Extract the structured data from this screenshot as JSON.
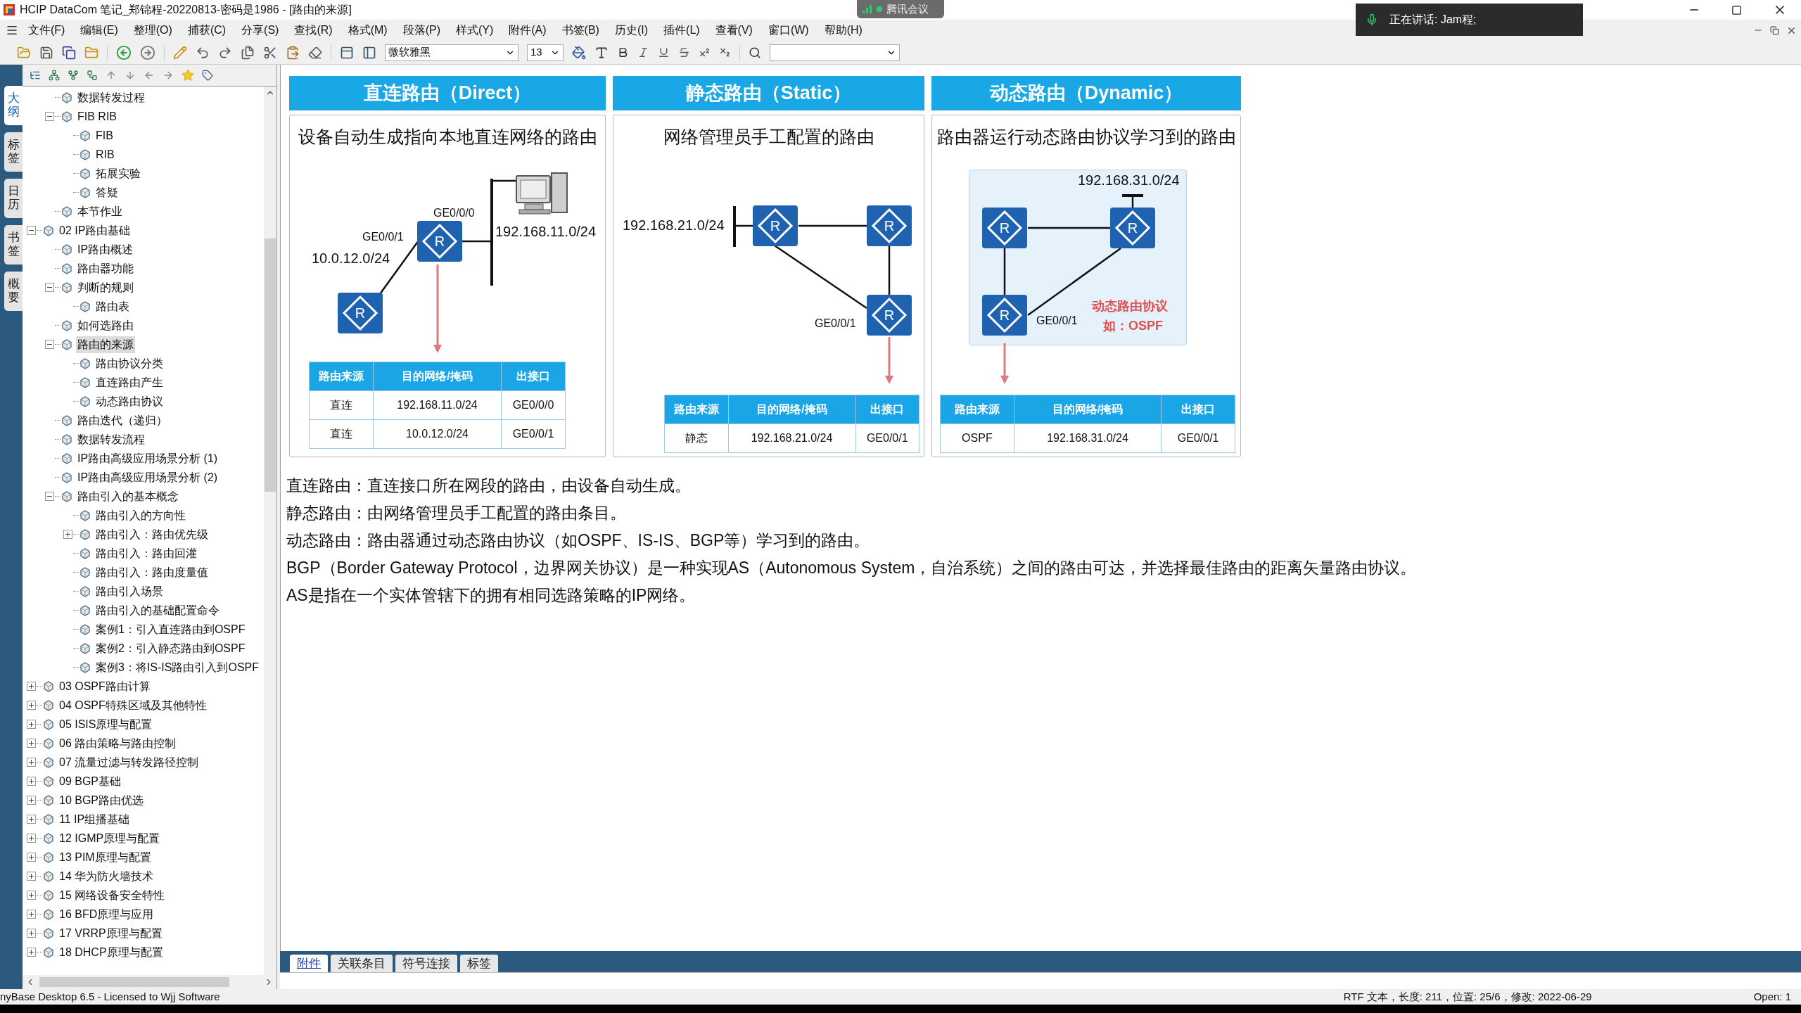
{
  "window": {
    "title": "HCIP DataCom 笔记_郑锦程-20220813-密码是1986 - [路由的来源]"
  },
  "meeting_badge": {
    "label": "腾讯会议"
  },
  "speaker": {
    "label": "正在讲话: Jam程;"
  },
  "menu": [
    "文件(F)",
    "编辑(E)",
    "整理(O)",
    "捕获(C)",
    "分享(S)",
    "查找(R)",
    "格式(M)",
    "段落(P)",
    "样式(Y)",
    "附件(A)",
    "书签(B)",
    "历史(I)",
    "插件(L)",
    "查看(V)",
    "窗口(W)",
    "帮助(H)"
  ],
  "toolbar": {
    "font": "微软雅黑",
    "size": "13"
  },
  "side_tabs": [
    {
      "label": "大纲",
      "selected": true
    },
    {
      "label": "标签",
      "selected": false
    },
    {
      "label": "日历",
      "selected": false
    },
    {
      "label": "书签",
      "selected": false
    },
    {
      "label": "概要",
      "selected": false
    }
  ],
  "tree": {
    "continued": [
      {
        "label": "数据转发过程",
        "selected": false
      },
      {
        "label": "FIB RIB",
        "selected": false,
        "expanded": true,
        "children": [
          {
            "label": "FIB",
            "selected": false
          },
          {
            "label": "RIB",
            "selected": false
          },
          {
            "label": "拓展实验",
            "selected": false
          },
          {
            "label": "答疑",
            "selected": false
          }
        ]
      },
      {
        "label": "本节作业",
        "selected": false
      }
    ],
    "items": [
      {
        "label": "02 IP路由基础",
        "selected": false,
        "expanded": true,
        "children": [
          {
            "label": "IP路由概述",
            "selected": false
          },
          {
            "label": "路由器功能",
            "selected": false
          },
          {
            "label": "判断的规则",
            "selected": false,
            "expanded": true,
            "children": [
              {
                "label": "路由表",
                "selected": false
              }
            ]
          },
          {
            "label": "如何选路由",
            "selected": false
          },
          {
            "label": "路由的来源",
            "selected": true,
            "expanded": true,
            "children": [
              {
                "label": "路由协议分类",
                "selected": false
              },
              {
                "label": "直连路由产生",
                "selected": false
              },
              {
                "label": "动态路由协议",
                "selected": false
              }
            ]
          },
          {
            "label": "路由迭代（递归）",
            "selected": false
          },
          {
            "label": "数据转发流程",
            "selected": false
          },
          {
            "label": "IP路由高级应用场景分析 (1)",
            "selected": false
          },
          {
            "label": "IP路由高级应用场景分析 (2)",
            "selected": false
          },
          {
            "label": "路由引入的基本概念",
            "selected": false,
            "expanded": true,
            "children": [
              {
                "label": "路由引入的方向性",
                "selected": false
              },
              {
                "label": "路由引入：路由优先级",
                "selected": false,
                "expanded": false
              },
              {
                "label": "路由引入：路由回灌",
                "selected": false
              },
              {
                "label": "路由引入：路由度量值",
                "selected": false
              },
              {
                "label": "路由引入场景",
                "selected": false
              },
              {
                "label": "路由引入的基础配置命令",
                "selected": false
              },
              {
                "label": "案例1：引入直连路由到OSPF",
                "selected": false
              },
              {
                "label": "案例2：引入静态路由到OSPF",
                "selected": false
              },
              {
                "label": "案例3：将IS-IS路由引入到OSPF",
                "selected": false
              }
            ]
          }
        ]
      },
      {
        "label": "03 OSPF路由计算",
        "selected": false,
        "expanded": false
      },
      {
        "label": "04 OSPF特殊区域及其他特性",
        "selected": false,
        "expanded": false
      },
      {
        "label": "05 ISIS原理与配置",
        "selected": false,
        "expanded": false
      },
      {
        "label": "06 路由策略与路由控制",
        "selected": false,
        "expanded": false
      },
      {
        "label": "07 流量过滤与转发路径控制",
        "selected": false,
        "expanded": false
      },
      {
        "label": "09 BGP基础",
        "selected": false,
        "expanded": false
      },
      {
        "label": "10 BGP路由优选",
        "selected": false,
        "expanded": false
      },
      {
        "label": "11 IP组播基础",
        "selected": false,
        "expanded": false
      },
      {
        "label": "12 IGMP原理与配置",
        "selected": false,
        "expanded": false
      },
      {
        "label": "13 PIM原理与配置",
        "selected": false,
        "expanded": false
      },
      {
        "label": "14 华为防火墙技术",
        "selected": false,
        "expanded": false
      },
      {
        "label": "15 网络设备安全特性",
        "selected": false,
        "expanded": false
      },
      {
        "label": "16 BFD原理与应用",
        "selected": false,
        "expanded": false
      },
      {
        "label": "17 VRRP原理与配置",
        "selected": false,
        "expanded": false
      },
      {
        "label": "18 DHCP原理与配置",
        "selected": false,
        "expanded": false
      }
    ]
  },
  "panels": [
    {
      "kind": "direct",
      "title": "直连路由（Direct）",
      "subtitle": "设备自动生成指向本地直连网络的路由",
      "routers": [
        "R",
        "R"
      ],
      "labels": [
        {
          "text": "GE0/0/0",
          "kind": "interface"
        },
        {
          "text": "GE0/0/1",
          "kind": "interface"
        },
        {
          "text": "10.0.12.0/24",
          "kind": "network"
        },
        {
          "text": "192.168.11.0/24",
          "kind": "network"
        }
      ],
      "table": {
        "columns": [
          "路由来源",
          "目的网络/掩码",
          "出接口"
        ],
        "rows": [
          [
            "直连",
            "192.168.11.0/24",
            "GE0/0/0"
          ],
          [
            "直连",
            "10.0.12.0/24",
            "GE0/0/1"
          ]
        ]
      }
    },
    {
      "kind": "static",
      "title": "静态路由（Static）",
      "subtitle": "网络管理员手工配置的路由",
      "routers": [
        "R",
        "R",
        "R"
      ],
      "labels": [
        {
          "text": "192.168.21.0/24",
          "kind": "network"
        },
        {
          "text": "GE0/0/1",
          "kind": "interface"
        }
      ],
      "table": {
        "columns": [
          "路由来源",
          "目的网络/掩码",
          "出接口"
        ],
        "rows": [
          [
            "静态",
            "192.168.21.0/24",
            "GE0/0/1"
          ]
        ]
      }
    },
    {
      "kind": "dynamic",
      "title": "动态路由（Dynamic）",
      "subtitle": "路由器运行动态路由协议学习到的路由",
      "routers": [
        "R",
        "R",
        "R"
      ],
      "labels": [
        {
          "text": "192.168.31.0/24",
          "kind": "network"
        },
        {
          "text": "动态路由协议",
          "kind": "protocol"
        },
        {
          "text": "GE0/0/1",
          "kind": "interface"
        },
        {
          "text": "如：OSPF",
          "kind": "protocol"
        }
      ],
      "table": {
        "columns": [
          "路由来源",
          "目的网络/掩码",
          "出接口"
        ],
        "rows": [
          [
            "OSPF",
            "192.168.31.0/24",
            "GE0/0/1"
          ]
        ]
      }
    }
  ],
  "paragraphs": [
    "直连路由：直连接口所在网段的路由，由设备自动生成。",
    "静态路由：由网络管理员手工配置的路由条目。",
    "动态路由：路由器通过动态路由协议（如OSPF、IS-IS、BGP等）学习到的路由。",
    "BGP（Border Gateway Protocol，边界网关协议）是一种实现AS（Autonomous System，自治系统）之间的路由可达，并选择最佳路由的距离矢量路由协议。",
    "AS是指在一个实体管辖下的拥有相同选路策略的IP网络。"
  ],
  "bottom_tabs": [
    {
      "label": "附件",
      "selected": true
    },
    {
      "label": "关联条目",
      "selected": false
    },
    {
      "label": "符号连接",
      "selected": false
    },
    {
      "label": "标签",
      "selected": false
    }
  ],
  "status_bar": {
    "license": "nyBase Desktop 6.5 - Licensed to Wjj Software",
    "info": "RTF 文本，长度: 211，位置: 25/6，修改: 2022-06-29",
    "open": "Open: 1"
  }
}
